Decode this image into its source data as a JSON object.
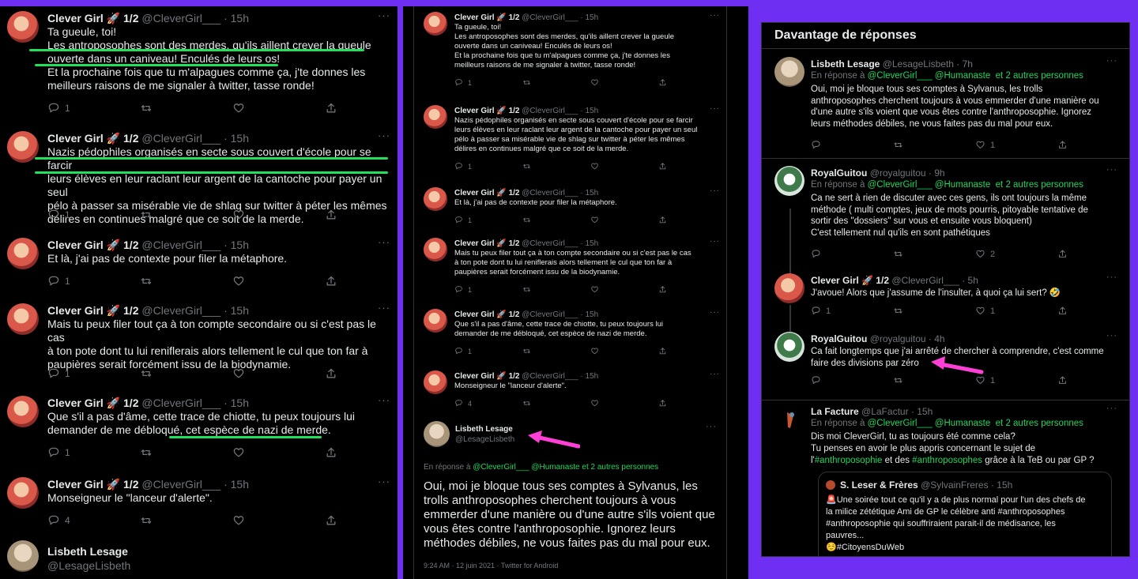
{
  "icons": {
    "reply": "reply-icon",
    "retweet": "retweet-icon",
    "like": "heart-icon",
    "share": "share-icon",
    "more": "more-icon",
    "arrow": "pink-arrow-icon"
  },
  "colors": {
    "background": "#6e2ff3",
    "panel": "#000000",
    "highlight": "#22e05a",
    "arrow": "#ff3fd6",
    "link": "#1fd65e"
  },
  "dots": "···",
  "col1": {
    "tweets": [
      {
        "name": "Clever Girl 🚀 1/2",
        "handle": "@CleverGirl___ · 15h",
        "body": "Ta gueule, toi!\nLes antroposophes sont des merdes, qu'ils aillent crever la gueule\nouverte dans un caniveau! Enculés de leurs os!\nEt la prochaine fois que tu m'alpagues comme ça, j'te donnes les\nmeilleurs raisons de me signaler à twitter, tasse ronde!",
        "reply_count": "1"
      },
      {
        "name": "Clever Girl 🚀 1/2",
        "handle": "@CleverGirl___ · 15h",
        "body": "Nazis pédophiles organisés en secte sous couvert d'école pour se farcir\nleurs élèves en leur raclant leur argent de la cantoche pour payer un seul\npélo à passer sa misérable vie de shlag sur twitter à péter les mêmes\ndélires en continues malgré que ce soit de la merde.",
        "reply_count": "1"
      },
      {
        "name": "Clever Girl 🚀 1/2",
        "handle": "@CleverGirl___ · 15h",
        "body": "Et là, j'ai pas de contexte pour filer la métaphore.",
        "reply_count": "1"
      },
      {
        "name": "Clever Girl 🚀 1/2",
        "handle": "@CleverGirl___ · 15h",
        "body": "Mais tu peux filer tout ça à ton compte secondaire ou si c'est pas le cas\nà ton pote dont tu lui reniflerais alors tellement le cul que ton far à\npaupières serait forcément issu de la biodynamie.",
        "reply_count": "1"
      },
      {
        "name": "Clever Girl 🚀 1/2",
        "handle": "@CleverGirl___ · 15h",
        "body": "Que s'il a pas d'âme, cette trace de chiotte, tu peux toujours lui\ndemander de me débloqué, cet espèce de nazi de merde.",
        "reply_count": "1"
      },
      {
        "name": "Clever Girl 🚀 1/2",
        "handle": "@CleverGirl___ · 15h",
        "body": "Monseigneur le \"lanceur d'alerte\".",
        "reply_count": "4"
      }
    ],
    "bottom": {
      "name": "Lisbeth Lesage",
      "handle": "@LesageLisbeth"
    }
  },
  "col2": {
    "tweets": [
      {
        "name": "Clever Girl 🚀 1/2",
        "handle": "@CleverGirl___ · 15h",
        "body": "Ta gueule, toi!\nLes antroposophes sont des merdes, qu'ils aillent crever la gueule\nouverte dans un caniveau! Enculés de leurs os!\nEt la prochaine fois que tu m'alpagues comme ça, j'te donnes les\nmeilleurs raisons de me signaler à twitter, tasse ronde!",
        "reply_count": "1"
      },
      {
        "name": "Clever Girl 🚀 1/2",
        "handle": "@CleverGirl___ · 15h",
        "body": "Nazis pédophiles organisés en secte sous couvert d'école pour se farcir\nleurs élèves en leur raclant leur argent de la cantoche pour payer un seul\npélo à passer sa misérable vie de shlag sur twitter à péter les mêmes\ndélires en continues malgré que ce soit de la merde.",
        "reply_count": "1"
      },
      {
        "name": "Clever Girl 🚀 1/2",
        "handle": "@CleverGirl___ · 15h",
        "body": "Et là, j'ai pas de contexte pour filer la métaphore.",
        "reply_count": "1"
      },
      {
        "name": "Clever Girl 🚀 1/2",
        "handle": "@CleverGirl___ · 15h",
        "body": "Mais tu peux filer tout ça à ton compte secondaire ou si c'est pas le cas\nà ton pote dont tu lui reniflerais alors tellement le cul que ton far à\npaupières serait forcément issu de la biodynamie.",
        "reply_count": "1"
      },
      {
        "name": "Clever Girl 🚀 1/2",
        "handle": "@CleverGirl___ · 15h",
        "body": "Que s'il a pas d'âme, cette trace de chiotte, tu peux toujours lui\ndemander de me débloqué, cet espèce de nazi de merde.",
        "reply_count": "1"
      },
      {
        "name": "Clever Girl 🚀 1/2",
        "handle": "@CleverGirl___ · 15h",
        "body": "Monseigneur le \"lanceur d'alerte\".",
        "reply_count": "4"
      }
    ],
    "main": {
      "name": "Lisbeth Lesage",
      "handle": "@LesageLisbeth",
      "reply_prefix": "En réponse à ",
      "reply_users": "@CleverGirl___ @Humanaste",
      "reply_others": "et 2 autres personnes",
      "body": "Oui, moi je bloque tous ses comptes à Sylvanus, les\ntrolls anthroposophes cherchent toujours à vous\nemmerder d'une manière ou d'une autre s'ils voient que\nvous êtes contre l'anthroposophie. Ignorez leurs\nméthodes débiles, ne vous faites pas du mal pour eux.",
      "meta": "9:24 AM · 12 juin 2021 · Twitter for Android"
    }
  },
  "col3": {
    "title": "Davantage de réponses",
    "replies": [
      {
        "name": "Lisbeth Lesage",
        "handle": "@LesageLisbeth · 7h",
        "reply_prefix": "En réponse à ",
        "reply_users": "@CleverGirl___ @Humanaste",
        "reply_others": "et 2 autres personnes",
        "body": "Oui, moi je bloque tous ses comptes à Sylvanus, les trolls\nanthroposophes cherchent toujours à vous emmerder d'une manière ou\nd'une autre s'ils voient que vous êtes contre l'anthroposophie. Ignorez\nleurs méthodes débiles, ne vous faites pas du mal pour eux.",
        "like_count": "1"
      },
      {
        "name": "RoyalGuitou",
        "handle": "@royalguitou · 9h",
        "reply_prefix": "En réponse à ",
        "reply_users": "@CleverGirl___ @Humanaste",
        "reply_others": "et 2 autres personnes",
        "body": "Ca ne sert à rien de discuter avec ces gens, ils ont toujours la même\nméthode ( multi comptes, jeux de mots pourris, pitoyable tentative de\nsortir des \"dossiers\" sur vous et ensuite vous bloquent)\nC'est tellement nul qu'ils en sont pathétiques",
        "like_count": "2"
      },
      {
        "name": "Clever Girl 🚀 1/2",
        "handle": "@CleverGirl___ · 5h",
        "body": "J'avoue! Alors que j'assume de l'insulter, à quoi ça lui sert? 🤣",
        "reply_count": "1",
        "like_count": "1"
      },
      {
        "name": "RoyalGuitou",
        "handle": "@royalguitou · 4h",
        "body": "Ca fait longtemps que j'ai arrêté de chercher à comprendre, c'est comme\nfaire des divisions par zéro",
        "like_count": "1"
      },
      {
        "name": "La Facture",
        "handle": "@LaFactur · 15h",
        "reply_prefix": "En réponse à ",
        "reply_users": "@CleverGirl___ @Humanaste",
        "reply_others": "et 2 autres personnes",
        "body_line1": "Dis moi CleverGirl, tu as toujours été comme cela?",
        "body_line2": "Tu penses en avoir le plus appris concernant le sujet de",
        "body_l3_a": "l'",
        "body_l3_tag1": "#anthroposophie",
        "body_l3_b": " et des ",
        "body_l3_tag2": "#anthroposophes",
        "body_l3_c": " grâce à la TeB ou par GP ?"
      }
    ],
    "quote": {
      "name": "S. Leser & Frères",
      "handle": "@SylvainFreres · 15h",
      "body": "🚨Une soirée tout ce qu'il y a de plus normal pour l'un des chefs de\nla milice zététique Ami de GP le célèbre anti #anthroposophes\n#anthroposophie qui souffriraient parait-il de médisance, les\npauvres...\n☺️#CitoyensDuWeb"
    }
  }
}
